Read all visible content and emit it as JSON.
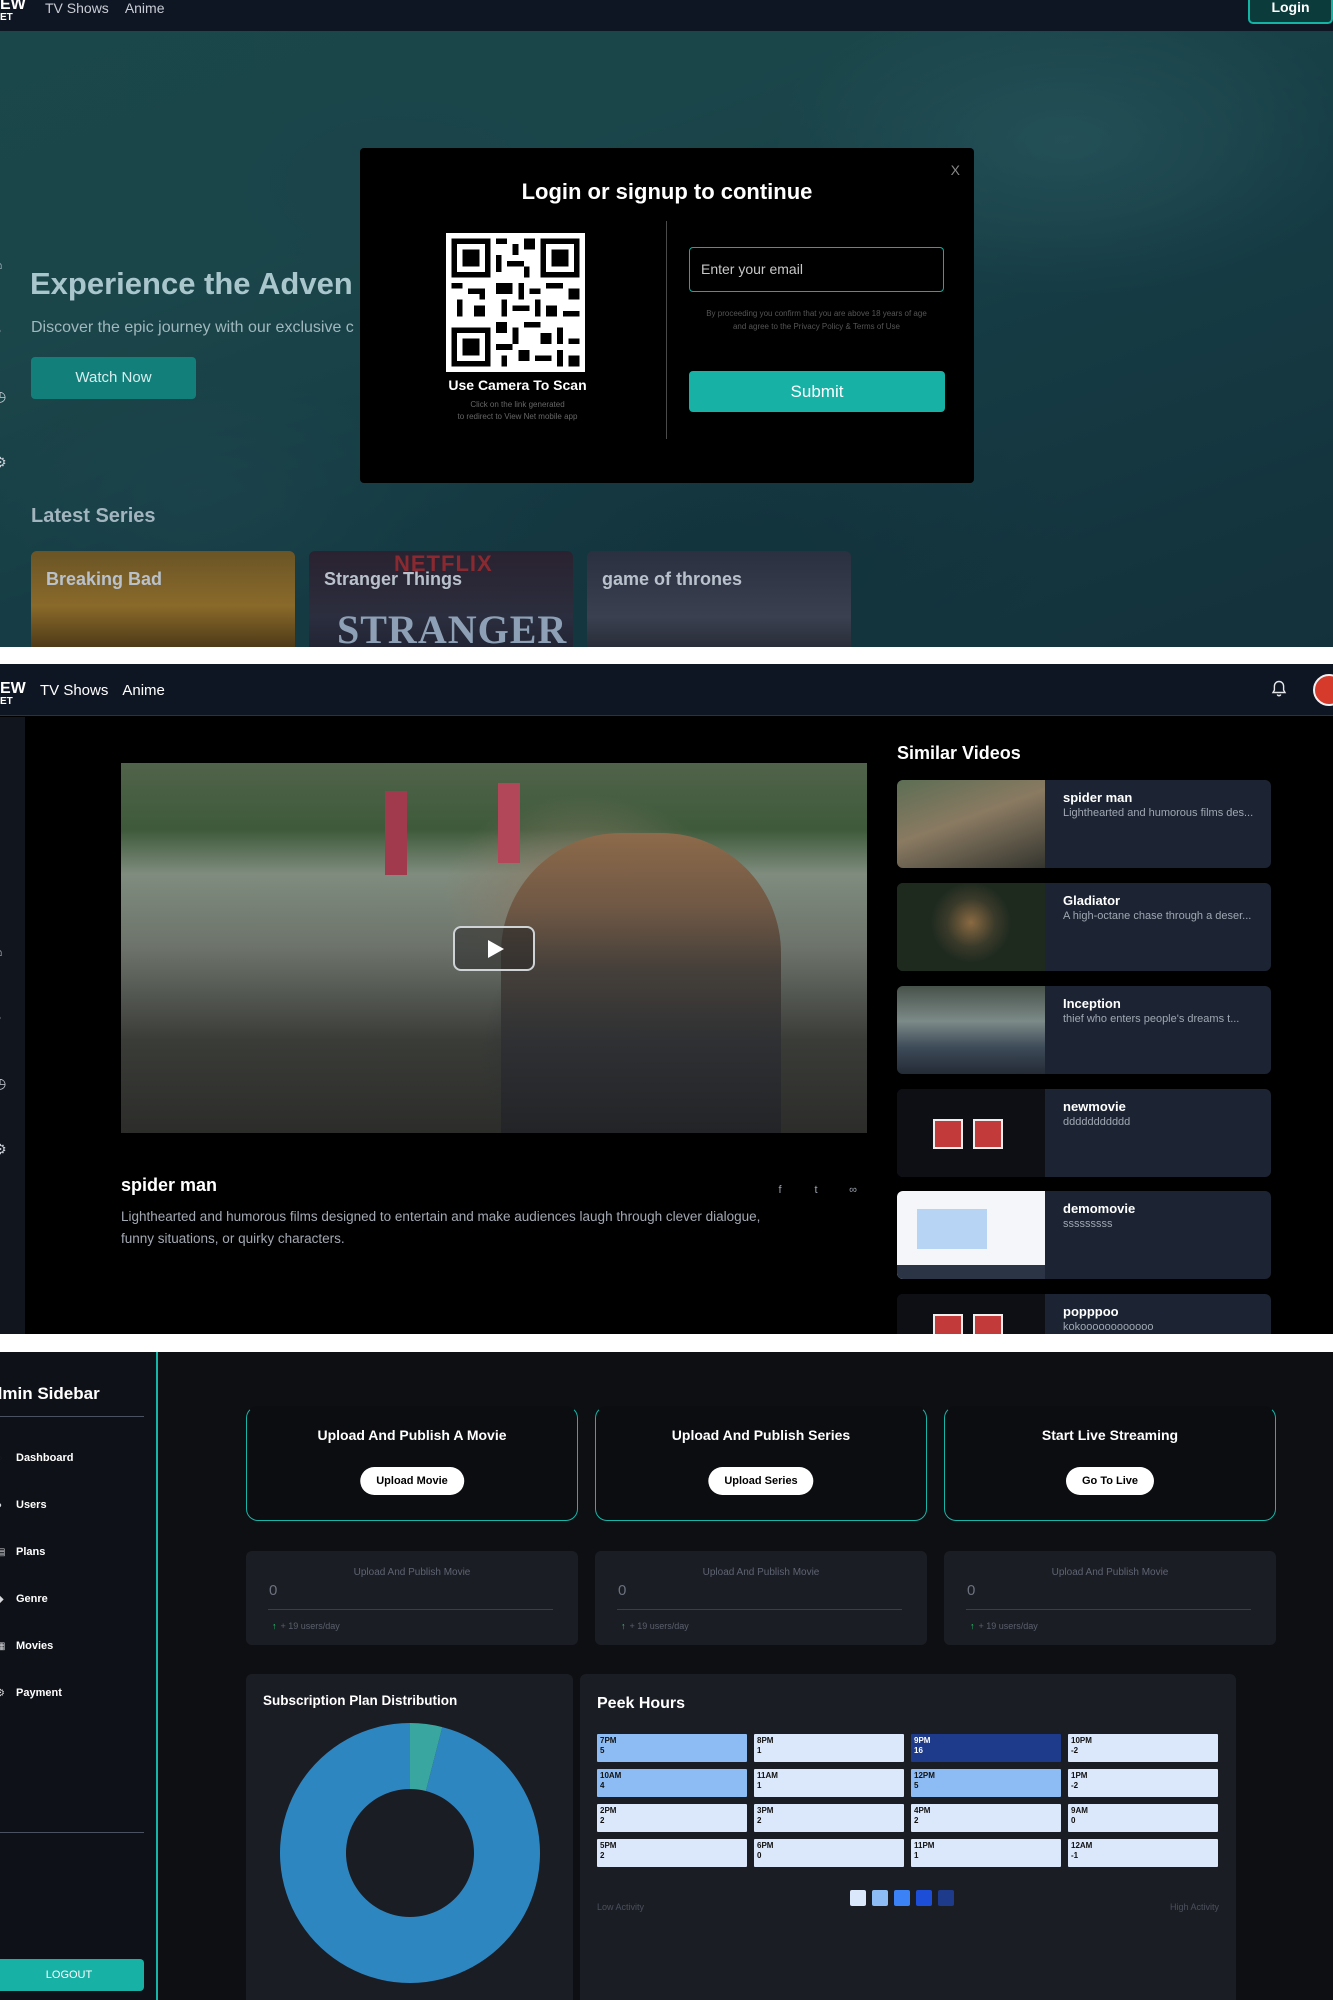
{
  "brand": {
    "line1": "EW",
    "line2": "ET"
  },
  "nav": {
    "tv_shows": "TV Shows",
    "anime": "Anime",
    "login": "Login"
  },
  "hero": {
    "title": "Experience the Adven",
    "subtitle": "Discover the epic journey with our exclusive c",
    "watch_now": "Watch Now",
    "latest_series": "Latest Series",
    "series": [
      {
        "title": "Breaking Bad"
      },
      {
        "title": "Stranger Things",
        "brand_text": "NETFLIX",
        "poster_text": "STRANGER"
      },
      {
        "title": "game of thrones"
      }
    ]
  },
  "login_modal": {
    "close": "X",
    "title": "Login or signup to continue",
    "qr_caption": "Use Camera To Scan",
    "qr_note_1": "Click on the link generated",
    "qr_note_2": "to redirect to View Net mobile app",
    "email_placeholder": "Enter your email",
    "terms_1": "By proceeding you confirm that you are above 18 years of age",
    "terms_2": "and agree to the Privacy Policy & Terms of Use",
    "submit": "Submit"
  },
  "video": {
    "title": "spider man",
    "description": "Lighthearted and humorous films designed to entertain and make audiences laugh through clever dialogue, funny situations, or quirky characters."
  },
  "similar": {
    "title": "Similar Videos",
    "items": [
      {
        "name": "spider man",
        "desc": "Lighthearted and humorous films des..."
      },
      {
        "name": "Gladiator",
        "desc": "A high-octane chase through a deser..."
      },
      {
        "name": "Inception",
        "desc": "thief who enters people's dreams t..."
      },
      {
        "name": "newmovie",
        "desc": "ddddddddddd"
      },
      {
        "name": "demomovie",
        "desc": "sssssssss"
      },
      {
        "name": "popppoo",
        "desc": "kokoooooooooooo"
      }
    ]
  },
  "admin": {
    "sidebar_title": "dmin Sidebar",
    "menu": [
      {
        "label": "Dashboard",
        "icon": "dashboard-icon"
      },
      {
        "label": "Users",
        "icon": "users-icon"
      },
      {
        "label": "Plans",
        "icon": "plans-icon"
      },
      {
        "label": "Genre",
        "icon": "genre-icon"
      },
      {
        "label": "Movies",
        "icon": "movies-icon"
      },
      {
        "label": "Payment",
        "icon": "payment-icon"
      }
    ],
    "logout": "LOGOUT",
    "actions": [
      {
        "title": "Upload And Publish A Movie",
        "button": "Upload Movie"
      },
      {
        "title": "Upload And Publish Series",
        "button": "Upload Series"
      },
      {
        "title": "Start Live Streaming",
        "button": "Go To Live"
      }
    ],
    "stats": [
      {
        "label": "Upload And Publish Movie",
        "value": "0",
        "footer": "+ 19 users/day"
      },
      {
        "label": "Upload And Publish Movie",
        "value": "0",
        "footer": "+ 19 users/day"
      },
      {
        "label": "Upload And Publish Movie",
        "value": "0",
        "footer": "+ 19 users/day"
      }
    ],
    "subscription_title": "Subscription Plan Distribution",
    "peek_title": "Peek Hours",
    "peek_cells": [
      {
        "hour": "7PM",
        "value": "5"
      },
      {
        "hour": "8PM",
        "value": "1"
      },
      {
        "hour": "9PM",
        "value": "16"
      },
      {
        "hour": "10PM",
        "value": "-2"
      },
      {
        "hour": "10AM",
        "value": "4"
      },
      {
        "hour": "11AM",
        "value": "1"
      },
      {
        "hour": "12PM",
        "value": "5"
      },
      {
        "hour": "1PM",
        "value": "-2"
      },
      {
        "hour": "2PM",
        "value": "2"
      },
      {
        "hour": "3PM",
        "value": "2"
      },
      {
        "hour": "4PM",
        "value": "2"
      },
      {
        "hour": "9AM",
        "value": "0"
      },
      {
        "hour": "5PM",
        "value": "2"
      },
      {
        "hour": "6PM",
        "value": "0"
      },
      {
        "hour": "11PM",
        "value": "1"
      },
      {
        "hour": "12AM",
        "value": "-1"
      }
    ],
    "low_activity": "Low Activity",
    "high_activity": "High Activity"
  },
  "colors": {
    "accent": "#17b1a6",
    "nav_bg": "#0f1623",
    "heat_low": "#dbe7fb",
    "heat_mid": "#8cbcf3",
    "heat_high": "#1e3a8a",
    "donut_main": "#2e86c1",
    "donut_minor": "#3aa6a0"
  },
  "chart_data": {
    "type": "pie",
    "title": "Subscription Plan Distribution",
    "values": [
      96,
      4
    ]
  }
}
